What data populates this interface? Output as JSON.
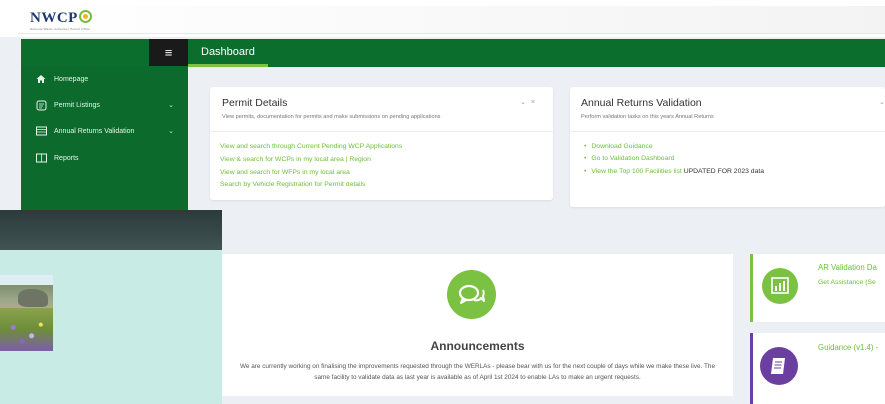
{
  "app": {
    "logo_text": "NWCP",
    "logo_subtitle": "National Waste Collection Permit Office"
  },
  "navbar": {
    "title": "Dashboard"
  },
  "sidebar": {
    "menu_icon": "hamburger-icon",
    "items": [
      {
        "label": "Homepage",
        "icon": "home-icon"
      },
      {
        "label": "Permit Listings",
        "icon": "listing-icon"
      },
      {
        "label": "Annual Returns Validation",
        "icon": "table-icon"
      },
      {
        "label": "Reports",
        "icon": "book-icon"
      }
    ]
  },
  "permit_card": {
    "title": "Permit Details",
    "subtitle": "View permits, documentation for permits and make submissions on pending applications",
    "links": [
      "View and search through Current Pending WCP Applications",
      "View & search for WCPs in my local area | Region",
      "View and search for WFPs in my local area",
      "Search by Vehicle Registration for Permit details"
    ]
  },
  "returns_card": {
    "title": "Annual Returns Validation",
    "subtitle": "Perform validation tasks on this years Annual Returns",
    "items": [
      {
        "link": "Download Guidance",
        "text": ""
      },
      {
        "link": "Go to Validation Dashboard",
        "text": ""
      },
      {
        "link": "View the Top 100 Facilities list",
        "text": "UPDATED FOR 2023 data"
      }
    ]
  },
  "announcements": {
    "icon": "chat-bubbles-icon",
    "title": "Announcements",
    "body": "We are currently working on finalising the improvements requested through the WERLAs - please bear with us for the next couple of days while we make these live.  The same facility to validate data as last year is available as of April 1st 2024 to enable LAs to make an urgent requests."
  },
  "side_cards": [
    {
      "title": "AR Validation Da",
      "link": "Get Assistance (Se",
      "icon": "bar-chart-icon"
    },
    {
      "title": "Guidance (v1.4) -",
      "link": "",
      "icon": "document-icon"
    }
  ],
  "colors": {
    "navbar_green": "#0b6e2c",
    "accent_green": "#7cc242",
    "link_green": "#6cbf38",
    "guidance_purple": "#6b3fa0",
    "overlay_teal": "#c9ebe6"
  }
}
